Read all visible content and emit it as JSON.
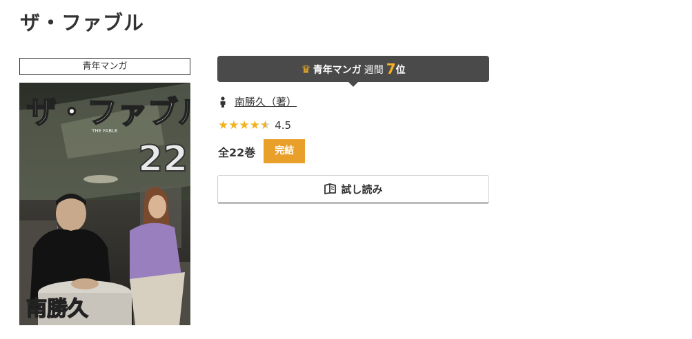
{
  "title": "ザ・ファブル",
  "genre_label": "青年マンガ",
  "cover": {
    "title_text": "ザ・ファブル",
    "subtitle_text": "THE FABLE",
    "volume_number": "22",
    "author_text": "南勝久"
  },
  "ranking": {
    "crown_icon": "crown-icon",
    "genre": "青年マンガ",
    "period": "週間",
    "rank": "7",
    "rank_suffix": "位"
  },
  "author": {
    "icon": "person-icon",
    "name": "南勝久（著）"
  },
  "rating": {
    "value": "4.5",
    "stars": 4.5,
    "max": 5
  },
  "volumes": {
    "count_text": "全22巻",
    "status_label": "完結"
  },
  "trial_button": {
    "icon": "book-icon",
    "label": "試し読み"
  },
  "colors": {
    "accent_gold": "#f5b324",
    "badge_orange": "#e8a02b",
    "banner_dark": "#4a4a4a"
  }
}
